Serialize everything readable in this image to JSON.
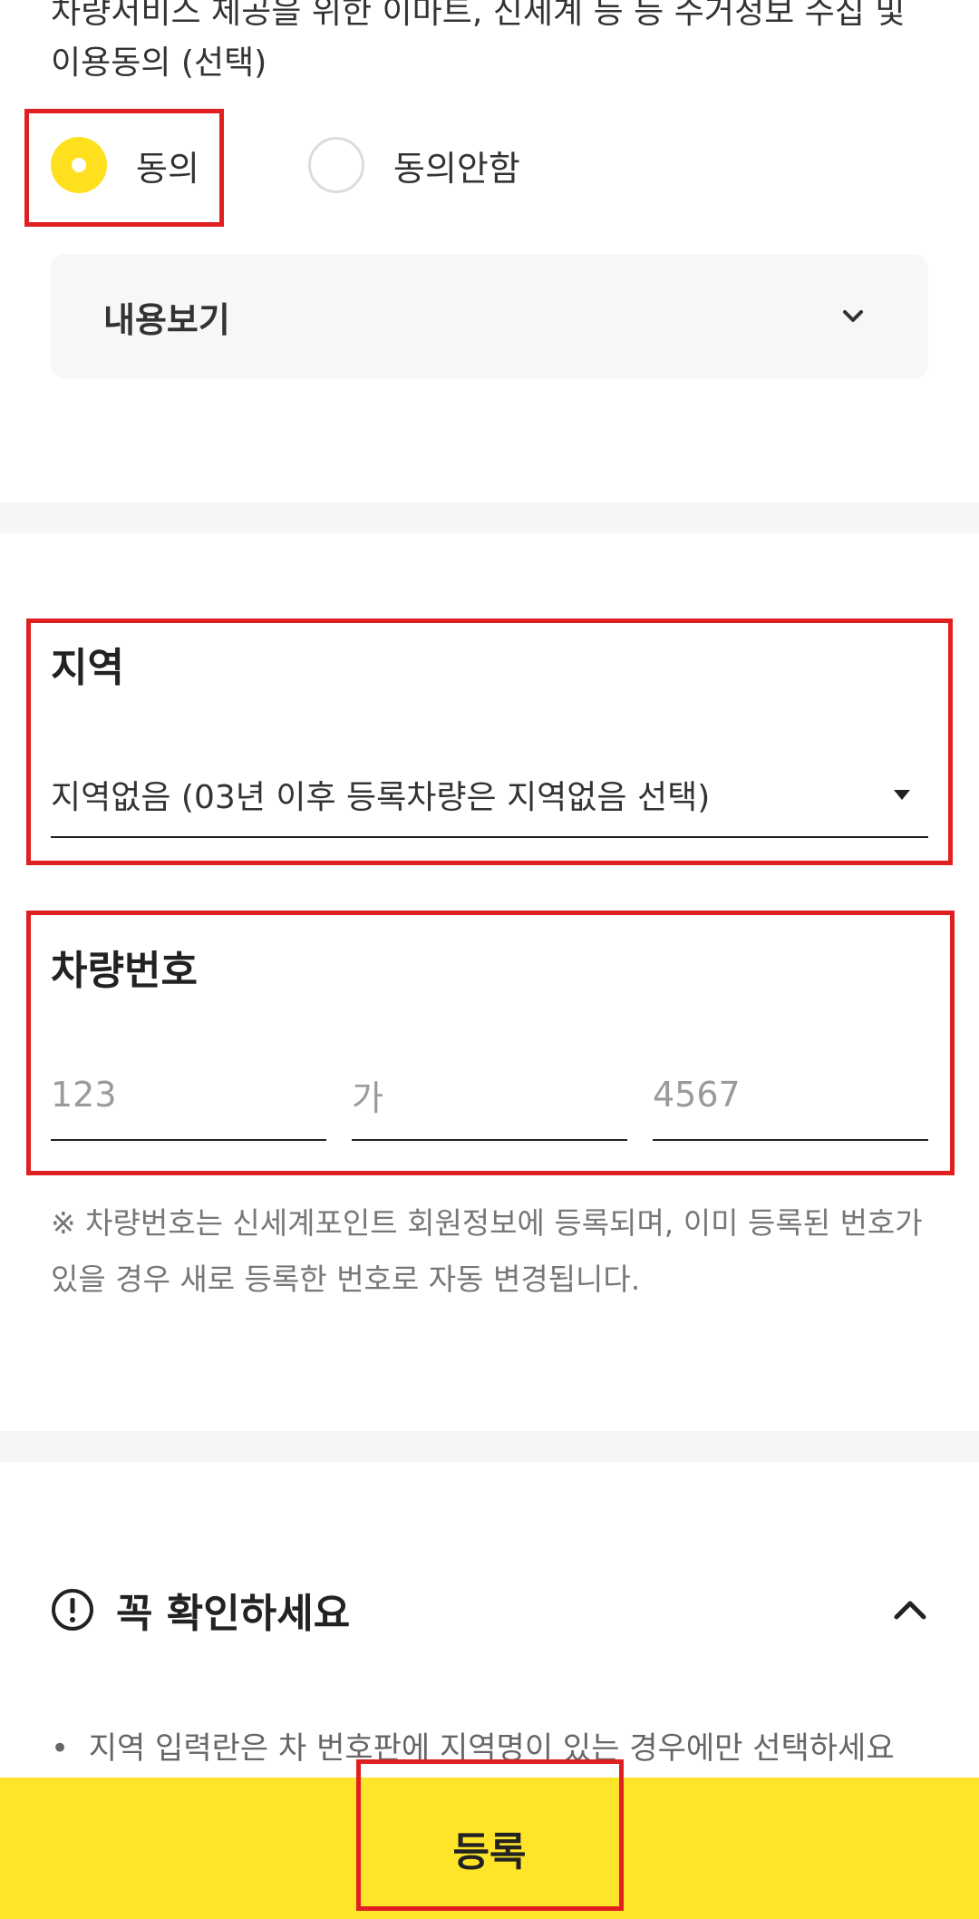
{
  "consent": {
    "text_line1": "차량서비스 제공을 위한 이마트, 신세계 등 등 수거정보 수집 및",
    "text_line2": "이용동의 (선택)",
    "options": [
      {
        "label": "동의",
        "selected": true
      },
      {
        "label": "동의안함",
        "selected": false
      }
    ],
    "details_label": "내용보기"
  },
  "region": {
    "title": "지역",
    "selected_value": "지역없음 (03년 이후 등록차량은 지역없음 선택)"
  },
  "plate": {
    "title": "차량번호",
    "inputs": [
      {
        "placeholder": "123"
      },
      {
        "placeholder": "가"
      },
      {
        "placeholder": "4567"
      }
    ],
    "note": "※ 차량번호는 신세계포인트 회원정보에 등록되며, 이미 등록된 번호가 있을 경우 새로 등록한 번호로 자동 변경됩니다."
  },
  "notice": {
    "title": "꼭 확인하세요",
    "items": [
      "지역 입력란은 차 번호판에 지역명이 있는 경우에만 선택하세요"
    ]
  },
  "footer": {
    "submit_label": "등록"
  },
  "colors": {
    "accent": "#ffe01f",
    "button": "#ffe52a",
    "highlight": "#e02020"
  }
}
